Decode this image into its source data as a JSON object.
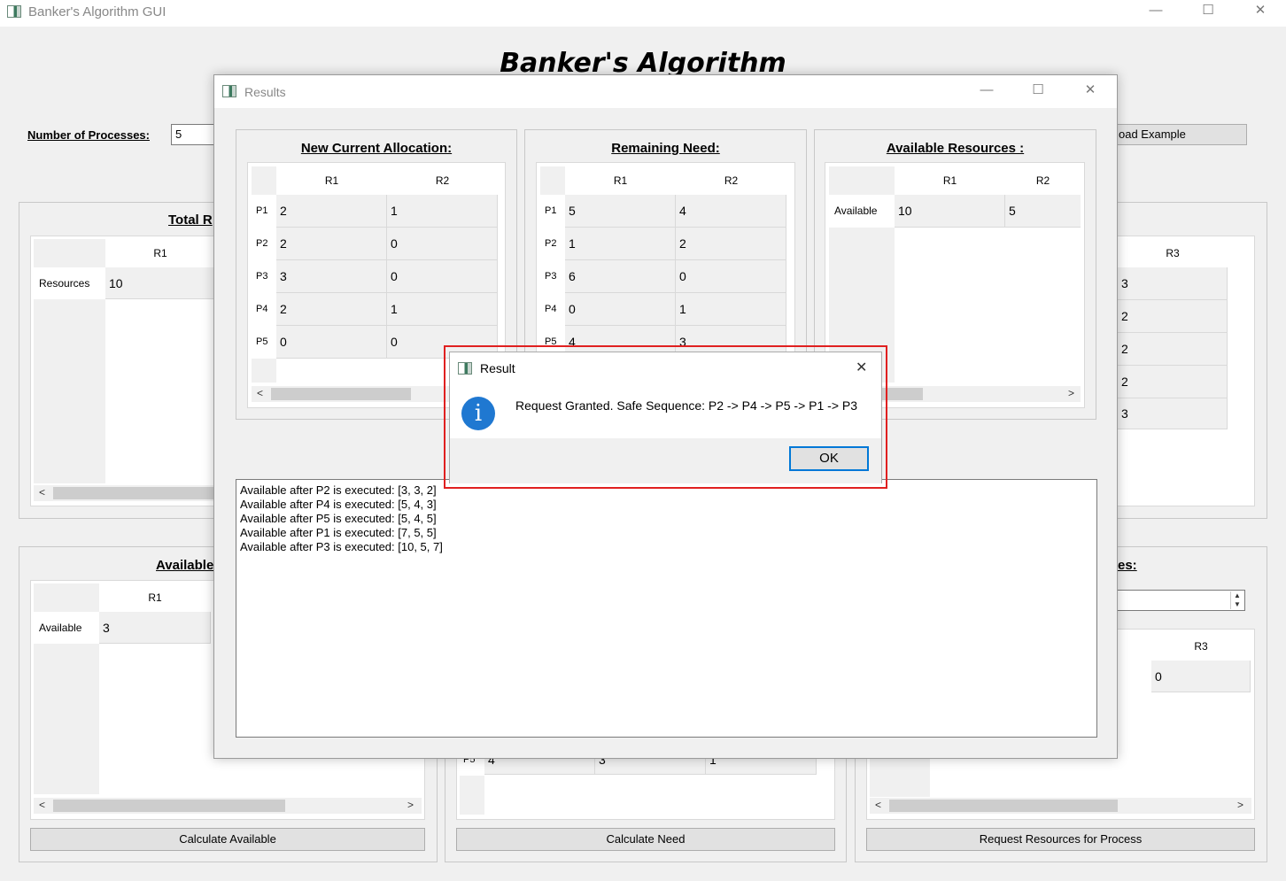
{
  "window": {
    "title": "Banker's Algorithm GUI",
    "minimize": "—",
    "maximize": "☐",
    "close": "✕"
  },
  "main": {
    "heading": "Banker's Algorithm",
    "num_processes_label": "Number of Processes:",
    "num_processes_value": "5",
    "load_example_button": "oad Example",
    "total_resources": {
      "title": "Total R",
      "col_r1": "R1",
      "col_r3": "R3",
      "row_label": "Resources",
      "r1_value": "10",
      "r3_values": [
        "3",
        "2",
        "2",
        "2",
        "3"
      ]
    },
    "available": {
      "title": "Available",
      "col_r1": "R1",
      "row_label": "Available",
      "r1_value": "3"
    },
    "request": {
      "title_fragment": "es:",
      "col_r3": "R3",
      "r3_value": "0"
    },
    "need_tail": {
      "row_label": "P5",
      "values": [
        "4",
        "3",
        "1"
      ]
    },
    "buttons": {
      "calc_available": "Calculate Available",
      "calc_need": "Calculate Need",
      "request_resources": "Request Resources for Process"
    }
  },
  "results_window": {
    "title": "Results",
    "allocation": {
      "title": "New Current Allocation:",
      "columns": [
        "R1",
        "R2"
      ],
      "rows": [
        {
          "label": "P1",
          "values": [
            "2",
            "1"
          ]
        },
        {
          "label": "P2",
          "values": [
            "2",
            "0"
          ]
        },
        {
          "label": "P3",
          "values": [
            "3",
            "0"
          ]
        },
        {
          "label": "P4",
          "values": [
            "2",
            "1"
          ]
        },
        {
          "label": "P5",
          "values": [
            "0",
            "0"
          ]
        }
      ]
    },
    "need": {
      "title": "Remaining Need:",
      "columns": [
        "R1",
        "R2"
      ],
      "rows": [
        {
          "label": "P1",
          "values": [
            "5",
            "4"
          ]
        },
        {
          "label": "P2",
          "values": [
            "1",
            "2"
          ]
        },
        {
          "label": "P3",
          "values": [
            "6",
            "0"
          ]
        },
        {
          "label": "P4",
          "values": [
            "0",
            "1"
          ]
        },
        {
          "label": "P5",
          "values": [
            "4",
            "3"
          ]
        }
      ]
    },
    "available": {
      "title": "Available Resources :",
      "columns": [
        "R1",
        "R2"
      ],
      "row_label": "Available",
      "values": [
        "10",
        "5"
      ]
    },
    "log": "Available after P2 is executed: [3, 3, 2]\nAvailable after P4 is executed: [5, 4, 3]\nAvailable after P5 is executed: [5, 4, 5]\nAvailable after P1 is executed: [7, 5, 5]\nAvailable after P3 is executed: [10, 5, 7]"
  },
  "dialog": {
    "title": "Result",
    "message": "Request Granted. Safe Sequence:  P2 -> P4 -> P5 -> P1 -> P3",
    "ok_button": "OK",
    "icon": "info-icon",
    "highlight_color": "#e02020"
  }
}
